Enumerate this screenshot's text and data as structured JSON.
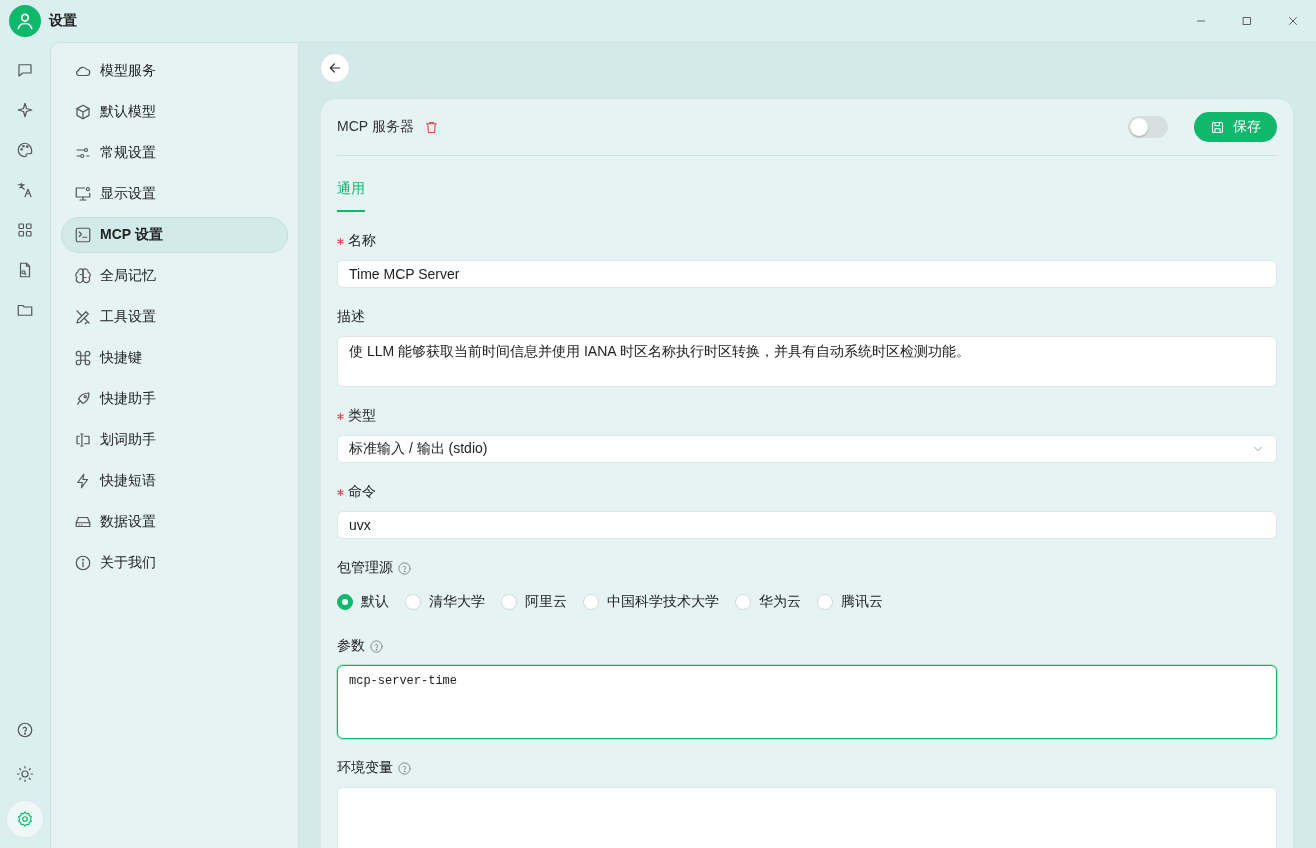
{
  "window": {
    "title": "设置"
  },
  "rail": {
    "top_items": [
      {
        "kind": "chat",
        "selected": false
      },
      {
        "kind": "sparkle",
        "selected": false
      },
      {
        "kind": "palette",
        "selected": false
      },
      {
        "kind": "translate",
        "selected": false
      },
      {
        "kind": "apps",
        "selected": false
      },
      {
        "kind": "file-search",
        "selected": false
      },
      {
        "kind": "folder",
        "selected": false
      }
    ],
    "bottom_items": [
      {
        "kind": "help",
        "selected": false
      },
      {
        "kind": "sun",
        "selected": false
      },
      {
        "kind": "gear",
        "selected": true
      }
    ]
  },
  "sidebar": {
    "items": [
      {
        "label": "模型服务",
        "kind": "cloud",
        "selected": false
      },
      {
        "label": "默认模型",
        "kind": "cube",
        "selected": false
      },
      {
        "label": "常规设置",
        "kind": "sliders",
        "selected": false
      },
      {
        "label": "显示设置",
        "kind": "monitor",
        "selected": false
      },
      {
        "label": "MCP 设置",
        "kind": "terminal",
        "selected": true
      },
      {
        "label": "全局记忆",
        "kind": "brain",
        "selected": false
      },
      {
        "label": "工具设置",
        "kind": "tools",
        "selected": false
      },
      {
        "label": "快捷键",
        "kind": "command",
        "selected": false
      },
      {
        "label": "快捷助手",
        "kind": "rocket",
        "selected": false
      },
      {
        "label": "划词助手",
        "kind": "cursor",
        "selected": false
      },
      {
        "label": "快捷短语",
        "kind": "bolt",
        "selected": false
      },
      {
        "label": "数据设置",
        "kind": "drive",
        "selected": false
      },
      {
        "label": "关于我们",
        "kind": "info",
        "selected": false
      }
    ]
  },
  "server": {
    "title": "MCP 服务器",
    "on": false,
    "save_button": "保存",
    "tabs": [
      {
        "label": "通用",
        "selected": true
      }
    ],
    "fields": [
      {
        "kind": "input",
        "label": "名称",
        "required": true,
        "value": "Time MCP Server"
      },
      {
        "kind": "textarea",
        "label": "描述",
        "required": false,
        "value": "使 LLM 能够获取当前时间信息并使用 IANA 时区名称执行时区转换，并具有自动系统时区检测功能。"
      },
      {
        "kind": "select",
        "label": "类型",
        "required": true,
        "value": "标准输入 / 输出 (stdio)"
      },
      {
        "kind": "input",
        "label": "命令",
        "required": true,
        "value": "uvx"
      },
      {
        "kind": "radio",
        "label": "包管理源",
        "help": true,
        "options": [
          {
            "label": "默认",
            "selected": true
          },
          {
            "label": "清华大学",
            "selected": false
          },
          {
            "label": "阿里云",
            "selected": false
          },
          {
            "label": "中国科学技术大学",
            "selected": false
          },
          {
            "label": "华为云",
            "selected": false
          },
          {
            "label": "腾讯云",
            "selected": false
          }
        ]
      },
      {
        "kind": "code",
        "label": "参数",
        "help": true,
        "focused": true,
        "value": "mcp-server-time"
      },
      {
        "kind": "code",
        "label": "环境变量",
        "help": true,
        "focused": false
      }
    ]
  }
}
